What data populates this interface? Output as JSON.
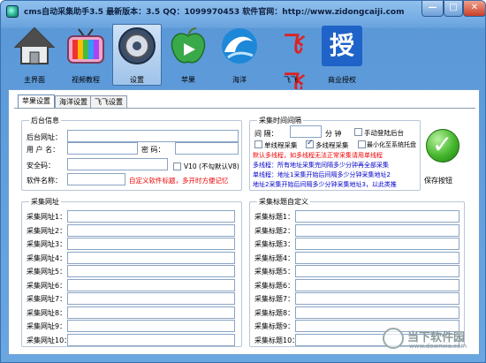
{
  "window": {
    "title": "cms自动采集助手3.5   最新版本：3.5   QQ：1099970453   软件官网：http://www.zidongcaiji.com",
    "min_label": "—",
    "max_label": "□",
    "close_label": "✕"
  },
  "toolbar": {
    "items": [
      {
        "label": "主界面",
        "icon": "house-icon"
      },
      {
        "label": "视频教程",
        "icon": "tv-icon"
      },
      {
        "label": "设置",
        "icon": "gear-icon"
      },
      {
        "label": "苹果",
        "icon": "apple-icon"
      },
      {
        "label": "海洋",
        "icon": "wave-icon"
      },
      {
        "label": "飞飞",
        "icon": "feifei-icon"
      },
      {
        "label": "商业授权",
        "icon": "license-icon"
      }
    ],
    "logo_text": {
      "feifei": "飞飞",
      "license": "授"
    }
  },
  "tabs": [
    "苹果设置",
    "海洋设置",
    "飞飞设置"
  ],
  "backend": {
    "legend": "后台信息",
    "url_label": "后台网址：",
    "user_label": "用 户 名：",
    "password_label": "密    码：",
    "safe_code_label": "安全码：",
    "software_name_label": "软件名称：",
    "v10_label": "V10 (不勾默认V8)",
    "custom_note": "自定义软件标题，多开时方便记忆",
    "url_value": "",
    "user_value": "",
    "password_value": "",
    "safe_code_value": "",
    "software_name_value": ""
  },
  "timer": {
    "legend": "采集时间间隔",
    "interval_label": "间    隔：",
    "interval_value": "",
    "unit": "分 钟",
    "manual_login_label": "手动登陆后台",
    "single_thread_label": "单线程采集",
    "multi_thread_label": "多线程采集",
    "minimize_label": "最小化至系统托盘",
    "note1": "默认多线程，如多线程无法正常采集请用单线程",
    "note2": "多线程：所有地址采集完间隔多少分钟再全部采集",
    "note3": "单线程：地址1采集开始后间隔多少分钟采集地址2",
    "note4": "地址2采集开始后间隔多少分钟采集地址3，以此类推"
  },
  "save": {
    "label": "保存按钮"
  },
  "collect_urls": {
    "legend": "采集网址",
    "items": [
      {
        "label": "采集网址1：",
        "value": ""
      },
      {
        "label": "采集网址2：",
        "value": ""
      },
      {
        "label": "采集网址3：",
        "value": ""
      },
      {
        "label": "采集网址4：",
        "value": ""
      },
      {
        "label": "采集网址5：",
        "value": ""
      },
      {
        "label": "采集网址6：",
        "value": ""
      },
      {
        "label": "采集网址7：",
        "value": ""
      },
      {
        "label": "采集网址8：",
        "value": ""
      },
      {
        "label": "采集网址9：",
        "value": ""
      },
      {
        "label": "采集网址10：",
        "value": ""
      }
    ]
  },
  "collect_titles": {
    "legend": "采集标题自定义",
    "items": [
      {
        "label": "采集标题1：",
        "value": ""
      },
      {
        "label": "采集标题2：",
        "value": ""
      },
      {
        "label": "采集标题3：",
        "value": ""
      },
      {
        "label": "采集标题4：",
        "value": ""
      },
      {
        "label": "采集标题5：",
        "value": ""
      },
      {
        "label": "采集标题6：",
        "value": ""
      },
      {
        "label": "采集标题7：",
        "value": ""
      },
      {
        "label": "采集标题8：",
        "value": ""
      },
      {
        "label": "采集标题9：",
        "value": ""
      },
      {
        "label": "采集标题10：",
        "value": ""
      }
    ]
  },
  "watermark": {
    "text": "当下软件园",
    "sub": "www.downxia.com"
  },
  "colors": {
    "title_bar": "#8fc0ee",
    "accent": "#5b98d8",
    "note_red": "#e00000",
    "note_blue": "#0000cc",
    "save_green": "#45b72c"
  }
}
